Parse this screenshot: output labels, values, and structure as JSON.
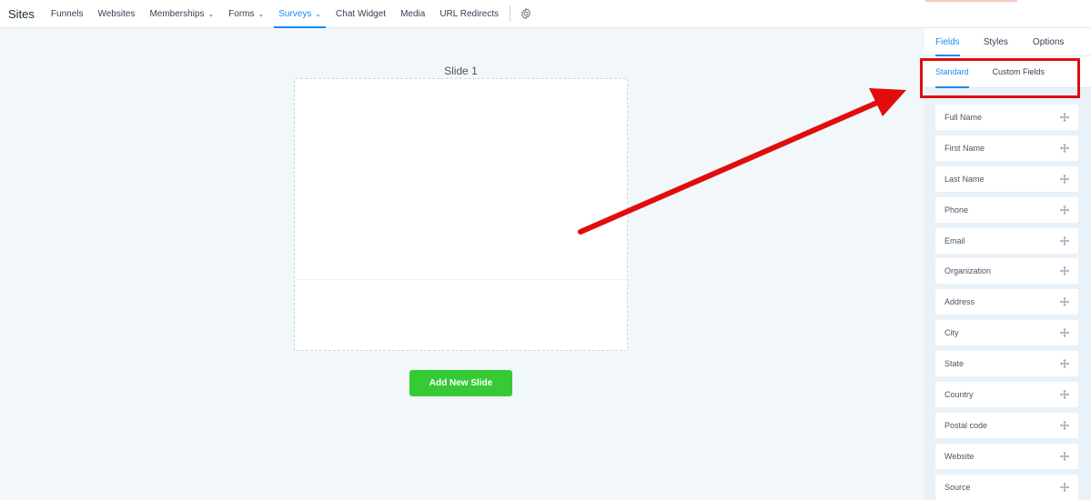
{
  "topnav": {
    "brand": "Sites",
    "items": [
      {
        "label": "Funnels"
      },
      {
        "label": "Websites"
      },
      {
        "label": "Memberships"
      },
      {
        "label": "Forms"
      },
      {
        "label": "Surveys"
      },
      {
        "label": "Chat Widget"
      },
      {
        "label": "Media"
      },
      {
        "label": "URL Redirects"
      }
    ],
    "settings_icon": "gear-icon"
  },
  "canvas": {
    "slide_title": "Slide 1",
    "add_slide_label": "Add New Slide"
  },
  "panel": {
    "tabs": [
      {
        "label": "Fields"
      },
      {
        "label": "Styles"
      },
      {
        "label": "Options"
      }
    ],
    "active_tab": "Fields",
    "sub_tabs": [
      {
        "label": "Standard"
      },
      {
        "label": "Custom Fields"
      }
    ],
    "active_sub_tab": "Standard",
    "fields": [
      {
        "label": "Full Name"
      },
      {
        "label": "First Name"
      },
      {
        "label": "Last Name"
      },
      {
        "label": "Phone"
      },
      {
        "label": "Email"
      },
      {
        "label": "Organization"
      },
      {
        "label": "Address"
      },
      {
        "label": "City"
      },
      {
        "label": "State"
      },
      {
        "label": "Country"
      },
      {
        "label": "Postal code"
      },
      {
        "label": "Website"
      },
      {
        "label": "Source"
      }
    ],
    "drag_icon": "move-icon"
  },
  "colors": {
    "accent": "#188bf6",
    "add_button": "#37ca37",
    "annotation": "#e10d0d",
    "background": "#f2f7fa",
    "panel_background": "#e9f2f9"
  }
}
